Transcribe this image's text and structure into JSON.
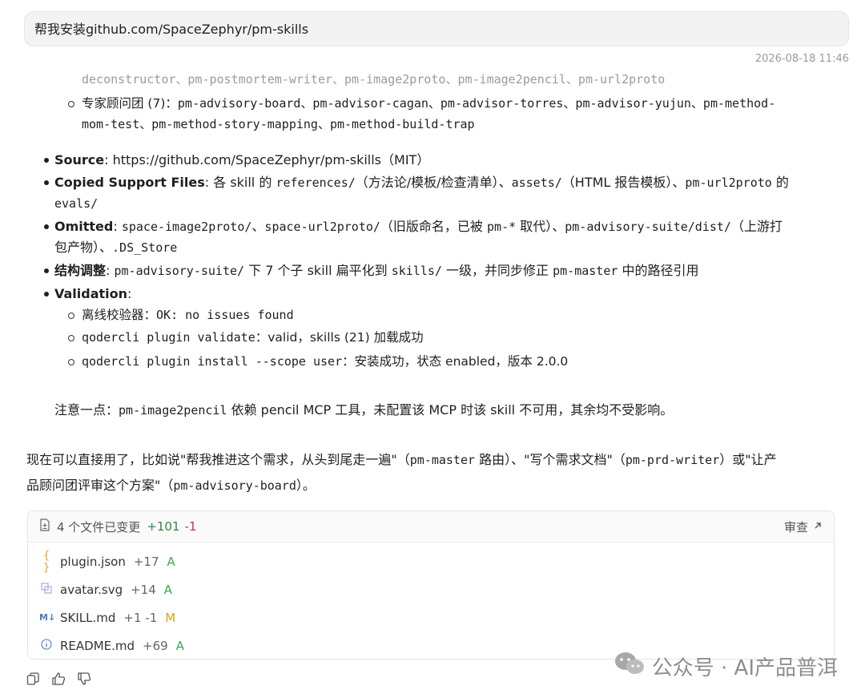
{
  "user_message": "帮我安装github.com/SpaceZephyr/pm-skills",
  "timestamp": "2026-08-18 11:46",
  "cut_line": "deconstructor、pm-postmortem-writer、pm-image2proto、pm-image2pencil、pm-url2proto",
  "advisory_group": {
    "label": "专家顾问团 (7)：",
    "items": "pm-advisory-board、pm-advisor-cagan、pm-advisor-torres、pm-advisor-yujun、pm-method-",
    "items_cont": "mom-test、pm-method-story-mapping、pm-method-build-trap"
  },
  "source": {
    "label": "Source",
    "value": ": https://github.com/SpaceZephyr/pm-skills（MIT）"
  },
  "copied": {
    "label": "Copied Support Files",
    "t1": ": 各 skill 的 ",
    "c1": "references/",
    "t2": "（方法论/模板/检查清单）、",
    "c2": "assets/",
    "t3": "（HTML 报告模板）、",
    "c3": "pm-url2proto",
    "t4": " 的",
    "c4": "evals/"
  },
  "omitted": {
    "label": "Omitted",
    "t0": ": ",
    "c1": "space-image2proto/",
    "t1": "、",
    "c2": "space-url2proto/",
    "t2": "（旧版命名，已被 ",
    "c3": "pm-*",
    "t3": " 取代）、",
    "c4": "pm-advisory-suite/dist/",
    "t4": "（上游打",
    "t5": "包产物）、",
    "c5": ".DS_Store"
  },
  "structure": {
    "label": "结构调整",
    "t0": ": ",
    "c1": "pm-advisory-suite/",
    "t1": " 下 7 个子 skill 扁平化到 ",
    "c2": "skills/",
    "t2": " 一级，并同步修正 ",
    "c3": "pm-master",
    "t3": " 中的路径引用"
  },
  "validation": {
    "label": "Validation",
    "colon": ":",
    "items": [
      {
        "code": "",
        "pre": "离线校验器：",
        "c": "OK: no issues found",
        "post": ""
      },
      {
        "pre": "",
        "c": "qodercli plugin validate",
        "post": "：valid，skills (21) 加载成功"
      },
      {
        "pre": "",
        "c": "qodercli plugin install --scope user",
        "post": "：安装成功，状态 enabled，版本 2.0.0"
      }
    ]
  },
  "note": {
    "t0": "注意一点：",
    "c1": "pm-image2pencil",
    "t1": " 依赖 pencil MCP 工具，未配置该 MCP 时该 skill 不可用，其余均不受影响。"
  },
  "usage": {
    "t0": "现在可以直接用了，比如说\"帮我推进这个需求，从头到尾走一遍\"（",
    "c1": "pm-master",
    "t1": " 路由）、\"写个需求文档\"（",
    "c2": "pm-prd-writer",
    "t2": "）或\"让产",
    "t3": "品顾问团评审这个方案\"（",
    "c3": "pm-advisory-board",
    "t4": "）。"
  },
  "files": {
    "summary": "4 个文件已变更",
    "plus": "+101",
    "minus": "-1",
    "review": "审查",
    "list": [
      {
        "icon": "json-icon",
        "name": "plugin.json",
        "diff": "+17",
        "status": "A"
      },
      {
        "icon": "image-icon",
        "name": "avatar.svg",
        "diff": "+14",
        "status": "A"
      },
      {
        "icon": "markdown-icon",
        "name": "SKILL.md",
        "diff": "+1 -1",
        "status": "M"
      },
      {
        "icon": "info-icon",
        "name": "README.md",
        "diff": "+69",
        "status": "A"
      }
    ]
  },
  "watermark": "公众号 · AI产品普洱",
  "colors": {
    "accent_green": "#3aa655",
    "accent_yellow": "#d9a21b",
    "minus_red": "#c23a3a"
  }
}
